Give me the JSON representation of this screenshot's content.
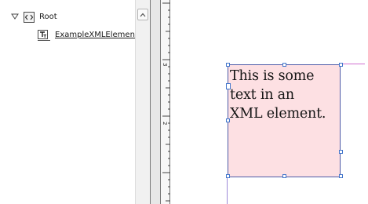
{
  "structure": {
    "root": {
      "label": "Root",
      "expanded": true
    },
    "child": {
      "label": "ExampleXMLElement"
    }
  },
  "ruler": {
    "labels": [
      "3",
      "2"
    ]
  },
  "frame": {
    "text": "This is some\ntext in an\nXML element."
  },
  "colors": {
    "frame_fill": "#fde0e3",
    "frame_border": "#4d5aa7",
    "handle_border": "#4477cc",
    "guide": "#d070d0"
  },
  "icons": {
    "expand": "triangle-down-icon",
    "element": "xml-element-icon",
    "text": "text-content-icon",
    "scroll_up": "chevron-up-icon"
  }
}
